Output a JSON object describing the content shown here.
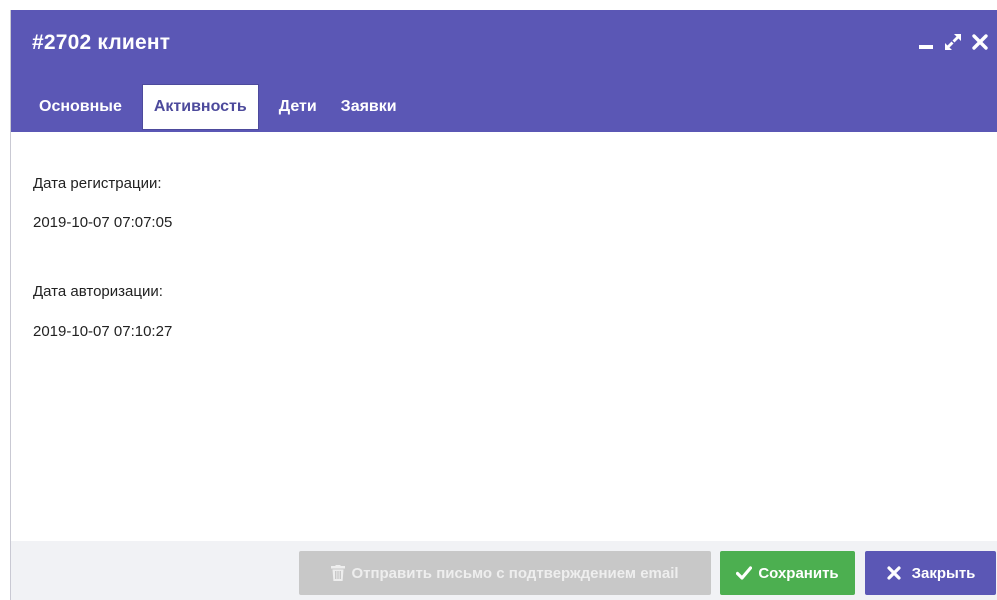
{
  "window": {
    "title": "#2702 клиент",
    "controls": [
      {
        "name": "minimize",
        "icon": "minimize-icon"
      },
      {
        "name": "maximize",
        "icon": "expand-icon"
      },
      {
        "name": "close",
        "icon": "close-icon"
      }
    ]
  },
  "tabs": [
    {
      "label": "Основные",
      "active": false
    },
    {
      "label": "Активность",
      "active": true
    },
    {
      "label": "Дети",
      "active": false
    },
    {
      "label": "Заявки",
      "active": false
    }
  ],
  "activity": {
    "registration_label": "Дата регистрации:",
    "registration_value": "2019-10-07 07:07:05",
    "authorization_label": "Дата авторизации:",
    "authorization_value": "2019-10-07 07:10:27"
  },
  "footer": {
    "send_email_label": "Отправить письмо с подтверждением email",
    "send_email_icon": "trash-icon",
    "send_email_disabled": true,
    "save_label": "Сохранить",
    "save_icon": "check-icon",
    "close_label": "Закрыть",
    "close_icon": "close-icon"
  },
  "colors": {
    "header": "#5b57b5",
    "save": "#4caf50",
    "close": "#5b57b5",
    "disabled": "#c8c8c8"
  }
}
